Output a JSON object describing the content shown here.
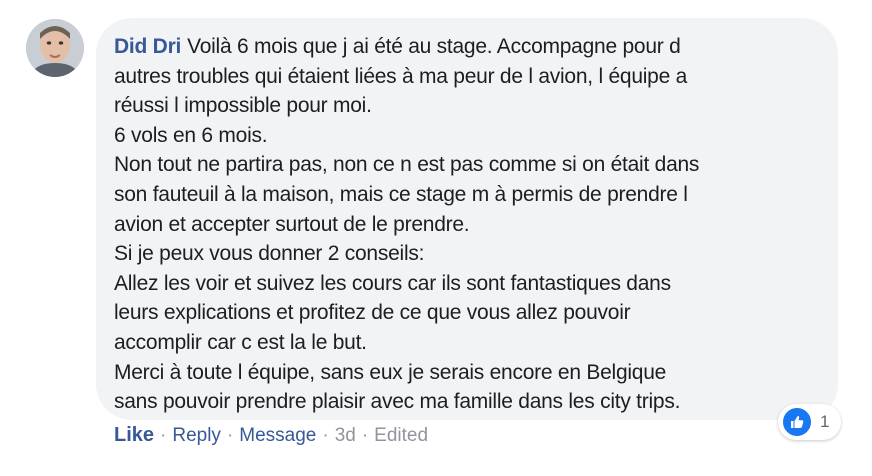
{
  "comment": {
    "author": "Did Dri",
    "lines": [
      "Voilà 6 mois que j ai été au stage. Accompagne pour d",
      "autres troubles qui étaient liées à ma peur de l avion, l équipe a",
      "réussi l impossible pour moi.",
      "6 vols en 6 mois.",
      "Non tout ne partira pas, non ce n est pas comme si on était dans",
      "son fauteuil à la maison, mais ce stage m à permis de prendre l",
      "avion et accepter surtout de le prendre.",
      "Si je peux vous donner 2 conseils:",
      "Allez les voir et suivez les cours car ils sont fantastiques dans",
      "leurs explications et profitez de ce que vous allez pouvoir",
      "accomplir car c est la le but.",
      "Merci à toute l équipe, sans eux je serais encore en Belgique",
      "sans pouvoir prendre plaisir avec ma famille dans les city trips."
    ]
  },
  "reactions": {
    "icon": "like-thumb-icon",
    "count": "1",
    "color": "#1877f2"
  },
  "actions": {
    "like": "Like",
    "reply": "Reply",
    "message": "Message",
    "time": "3d",
    "edited": "Edited",
    "separator": "·"
  },
  "colors": {
    "bubble": "#f2f3f5",
    "author": "#385898",
    "text": "#1c1e21",
    "meta": "#90949c"
  }
}
